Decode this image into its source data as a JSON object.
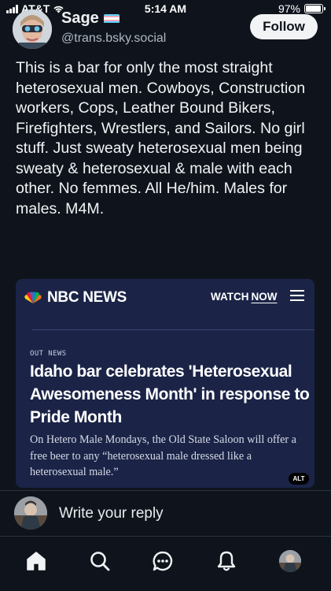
{
  "status_bar": {
    "carrier": "AT&T",
    "time": "5:14 AM",
    "battery_percent": "97%",
    "battery_level": 0.97
  },
  "post": {
    "author": {
      "display_name": "Sage",
      "handle": "@trans.bsky.social",
      "badge_icon": "trans-flag-icon"
    },
    "follow_label": "Follow",
    "text": "This is a bar for only the most straight heterosexual men. Cowboys, Construction workers, Cops, Leather Bound Bikers, Firefighters, Wrestlers, and Sailors. No girl stuff. Just sweaty heterosexual men being sweaty & heterosexual & male with each other. No femmes. All He/him. Males for males. M4M."
  },
  "embed": {
    "brand": "NBC NEWS",
    "watch_label": "WATCH",
    "now_label": "NOW",
    "section": "OUT NEWS",
    "headline": "Idaho bar celebrates 'Heterosexual Awesomeness Month' in response to Pride Month",
    "dek": "On Hetero Male Mondays, the Old State Saloon will offer a free beer to any “heterosexual male dressed like a heterosexual male.”",
    "alt_badge": "ALT",
    "colors": {
      "background": "#1b2447"
    }
  },
  "reply": {
    "placeholder": "Write your reply"
  },
  "tabs": [
    {
      "icon": "home-icon",
      "active": true
    },
    {
      "icon": "search-icon"
    },
    {
      "icon": "chat-icon"
    },
    {
      "icon": "bell-icon"
    },
    {
      "icon": "profile-avatar"
    }
  ],
  "colors": {
    "background": "#0f141c",
    "text": "#f1f3f5",
    "muted": "#aeb8c3",
    "follow_button_bg": "#f1f3f5"
  }
}
